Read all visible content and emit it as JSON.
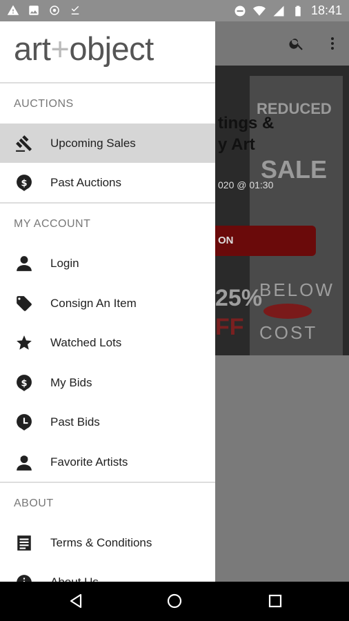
{
  "status_bar": {
    "time": "18:41"
  },
  "brand": {
    "logo_left": "art",
    "logo_plus": "+",
    "logo_right": "object"
  },
  "drawer": {
    "sections": [
      {
        "heading": "AUCTIONS"
      },
      {
        "heading": "MY ACCOUNT"
      },
      {
        "heading": "ABOUT"
      }
    ],
    "items": [
      {
        "label": "Upcoming Sales",
        "icon": "gavel-icon"
      },
      {
        "label": "Past Auctions",
        "icon": "dollar-circle-icon"
      },
      {
        "label": "Login",
        "icon": "person-icon"
      },
      {
        "label": "Consign An Item",
        "icon": "tag-icon"
      },
      {
        "label": "Watched Lots",
        "icon": "star-icon"
      },
      {
        "label": "My Bids",
        "icon": "dollar-pin-icon"
      },
      {
        "label": "Past Bids",
        "icon": "clock-pin-icon"
      },
      {
        "label": "Favorite Artists",
        "icon": "artist-icon"
      },
      {
        "label": "Terms & Conditions",
        "icon": "document-icon"
      },
      {
        "label": "About Us",
        "icon": "info-icon"
      }
    ]
  },
  "background": {
    "title_line1": "tings &",
    "title_line2": "y Art",
    "date": "020 @ 01:30",
    "button": "ON",
    "percent": "25%",
    "off": "FF",
    "below": "BELOW",
    "cost": "COST",
    "sale": "SALE",
    "reduced": "REDUCED"
  },
  "colors": {
    "accent": "#6a0a0a",
    "drawer_bg": "#ffffff",
    "active_bg": "#d6d6d6"
  }
}
